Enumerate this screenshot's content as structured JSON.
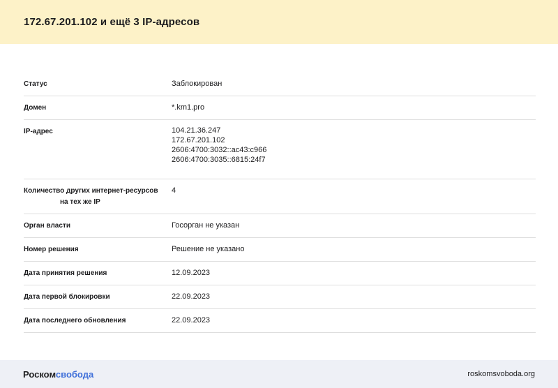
{
  "header": {
    "title": "172.67.201.102 и ещё 3 IP-адресов"
  },
  "details": {
    "status": {
      "label": "Статус",
      "value": "Заблокирован"
    },
    "domain": {
      "label": "Домен",
      "value": "*.km1.pro"
    },
    "ip": {
      "label": "IP-адрес",
      "values": [
        "104.21.36.247",
        "172.67.201.102",
        "2606:4700:3032::ac43:c966",
        "2606:4700:3035::6815:24f7"
      ]
    },
    "count": {
      "label_line1": "Количество других интернет-ресурсов",
      "label_line2": "на тех же IP",
      "value": "4"
    },
    "organ": {
      "label": "Орган власти",
      "value": "Госорган не указан"
    },
    "decision_number": {
      "label": "Номер решения",
      "value": "Решение не указано"
    },
    "decision_date": {
      "label": "Дата принятия решения",
      "value": "12.09.2023"
    },
    "first_block": {
      "label": "Дата первой блокировки",
      "value": "22.09.2023"
    },
    "last_update": {
      "label": "Дата последнего обновления",
      "value": "22.09.2023"
    }
  },
  "footer": {
    "logo_part1": "Роском",
    "logo_part2": "свобода",
    "site": "roskomsvoboda.org",
    "accent_color": "#3f6fd9"
  },
  "colors": {
    "header_bg": "#fdf2c8",
    "footer_bg": "#eef0f6",
    "divider": "#dedede"
  }
}
